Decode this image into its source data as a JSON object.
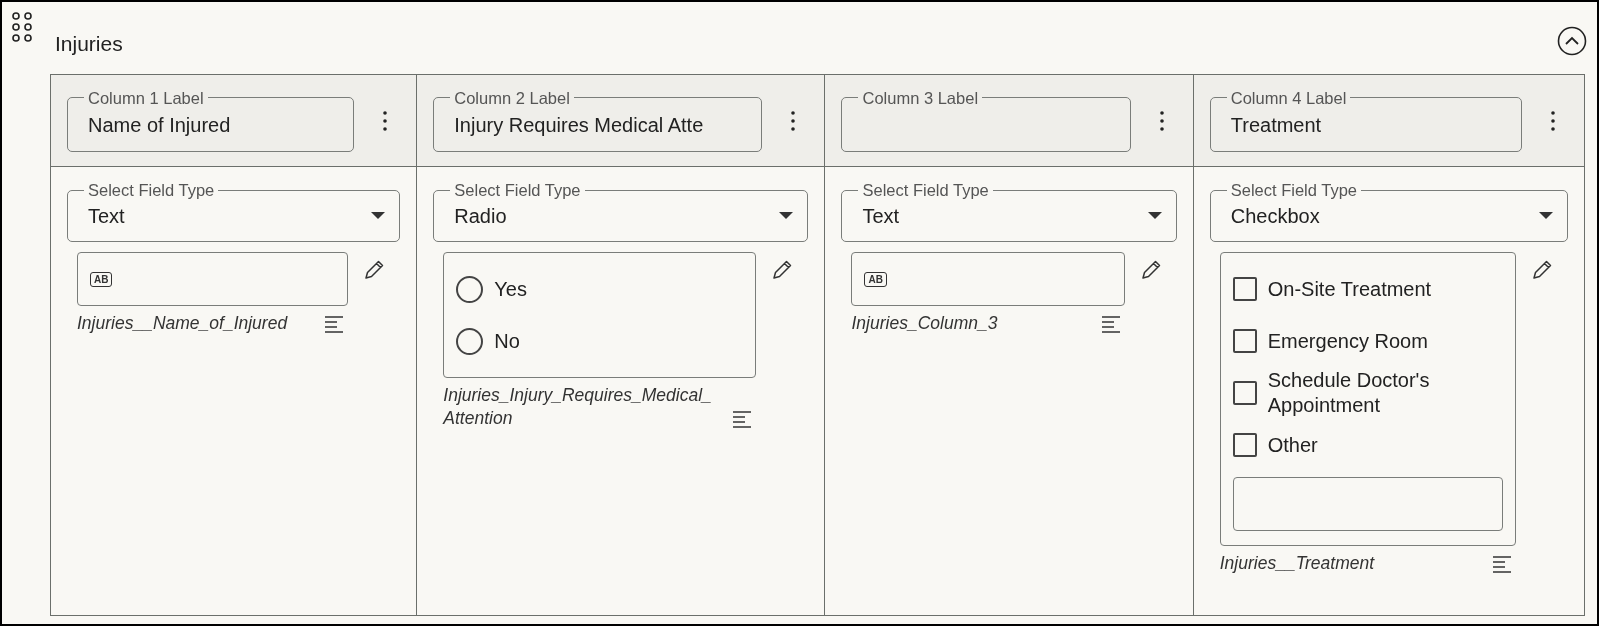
{
  "section": {
    "title": "Injuries",
    "expanded": true
  },
  "columns": [
    {
      "label_caption": "Column 1 Label",
      "label_value": "Name of Injured",
      "type_caption": "Select Field Type",
      "field_type": "Text",
      "kind": "text",
      "icon_text": "AB",
      "variable": "Injuries__Name_of_Injured"
    },
    {
      "label_caption": "Column 2 Label",
      "label_value": "Injury Requires Medical Atte",
      "type_caption": "Select Field Type",
      "field_type": "Radio",
      "kind": "radio",
      "options": [
        {
          "label": "Yes",
          "selected": false,
          "kind": "plain"
        },
        {
          "label": "No",
          "selected": false,
          "kind": "plain"
        }
      ],
      "variable": "Injuries_Injury_Requires_Medical_Attention"
    },
    {
      "label_caption": "Column 3 Label",
      "type_caption": "Select Field Type",
      "field_type": "Text",
      "kind": "text",
      "icon_text": "AB",
      "variable": "Injuries_Column_3"
    },
    {
      "label_caption": "Column 4 Label",
      "label_value": "Treatment",
      "type_caption": "Select Field Type",
      "field_type": "Checkbox",
      "kind": "checkbox",
      "options": [
        {
          "label": "On-Site Treatment",
          "checked": false,
          "kind": "plain"
        },
        {
          "label": "Emergency Room",
          "checked": false,
          "kind": "plain"
        },
        {
          "label": "Schedule Doctor's Appointment",
          "checked": false,
          "kind": "plain"
        },
        {
          "label": "Other",
          "checked": false,
          "kind": "other"
        }
      ],
      "variable": "Injuries__Treatment"
    }
  ]
}
